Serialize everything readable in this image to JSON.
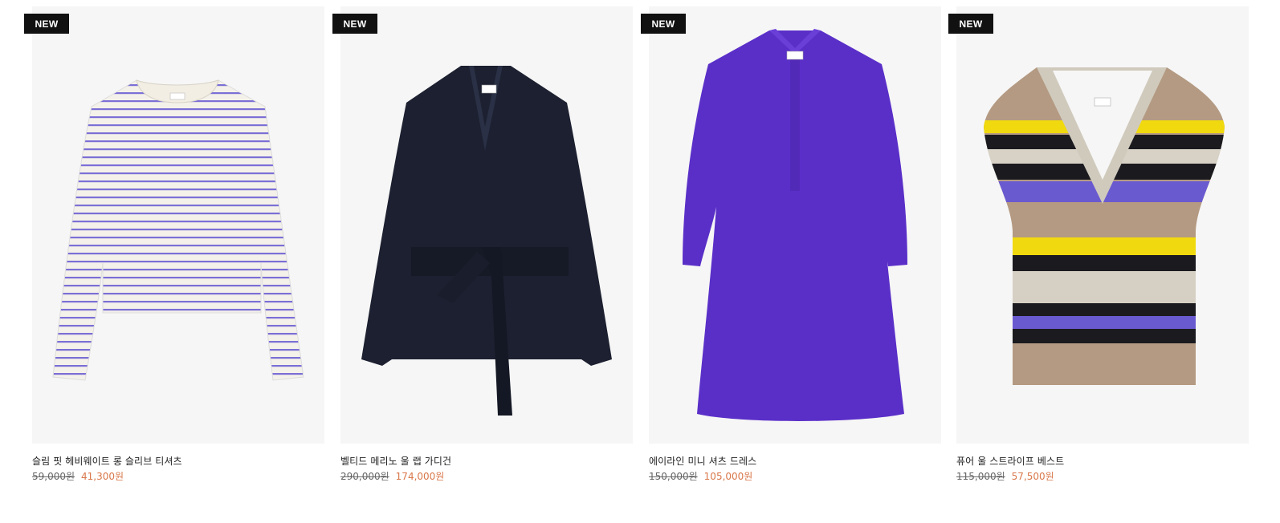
{
  "products": [
    {
      "badge": "NEW",
      "name": "슬림 핏 헤비웨이트 롱 슬리브 티셔츠",
      "original_price": "59,000원",
      "sale_price": "41,300원",
      "garment": "striped-long-sleeve-tshirt",
      "color": "#7b6fd6"
    },
    {
      "badge": "NEW",
      "name": "벨티드 메리노 울 랩 가디건",
      "original_price": "290,000원",
      "sale_price": "174,000원",
      "garment": "belted-wrap-cardigan",
      "color": "#1c2030"
    },
    {
      "badge": "NEW",
      "name": "에이라인 미니 셔츠 드레스",
      "original_price": "150,000원",
      "sale_price": "105,000원",
      "garment": "a-line-shirt-dress",
      "color": "#5a2fc8"
    },
    {
      "badge": "NEW",
      "name": "퓨어 울 스트라이프 베스트",
      "original_price": "115,000원",
      "sale_price": "57,500원",
      "garment": "striped-knit-vest",
      "color": "#b49a82"
    }
  ],
  "colors": {
    "badge_bg": "#111111",
    "sale_price": "#d9774a",
    "card_bg": "#f6f6f6"
  }
}
